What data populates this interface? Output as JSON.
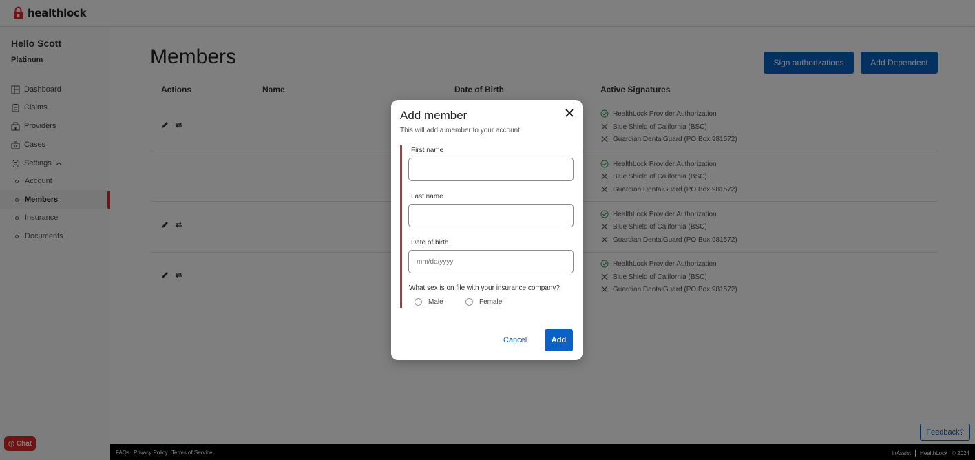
{
  "app": {
    "brand": "healthlock"
  },
  "sidebar": {
    "greeting": "Hello Scott",
    "tier": "Platinum",
    "items": [
      {
        "label": "Dashboard",
        "icon": "dashboard-icon"
      },
      {
        "label": "Claims",
        "icon": "clipboard-icon"
      },
      {
        "label": "Providers",
        "icon": "building-icon"
      },
      {
        "label": "Cases",
        "icon": "briefcase-icon"
      },
      {
        "label": "Settings",
        "icon": "gear-icon"
      }
    ],
    "sub_items": [
      {
        "label": "Account"
      },
      {
        "label": "Members",
        "active": true
      },
      {
        "label": "Insurance"
      },
      {
        "label": "Documents"
      }
    ]
  },
  "chat": {
    "label": "Chat"
  },
  "main": {
    "title": "Members",
    "sign_label": "Sign authorizations",
    "add_dependent_label": "Add Dependent",
    "columns": [
      "Actions",
      "Name",
      "Date of Birth",
      "Active Signatures"
    ],
    "rows": [
      {
        "has_actions": true,
        "signatures": [
          {
            "name": "HealthLock Provider Authorization",
            "status": "active"
          },
          {
            "name": "Blue Shield of California (BSC)",
            "status": "inactive"
          },
          {
            "name": "Guardian DentalGuard (PO Box 981572)",
            "status": "inactive"
          }
        ]
      },
      {
        "has_actions": false,
        "signatures": [
          {
            "name": "HealthLock Provider Authorization",
            "status": "active"
          },
          {
            "name": "Blue Shield of California (BSC)",
            "status": "inactive"
          },
          {
            "name": "Guardian DentalGuard (PO Box 981572)",
            "status": "inactive"
          }
        ]
      },
      {
        "has_actions": true,
        "signatures": [
          {
            "name": "HealthLock Provider Authorization",
            "status": "active"
          },
          {
            "name": "Blue Shield of California (BSC)",
            "status": "inactive"
          },
          {
            "name": "Guardian DentalGuard (PO Box 981572)",
            "status": "inactive"
          }
        ]
      },
      {
        "has_actions": true,
        "signatures": [
          {
            "name": "HealthLock Provider Authorization",
            "status": "active"
          },
          {
            "name": "Blue Shield of California (BSC)",
            "status": "inactive"
          },
          {
            "name": "Guardian DentalGuard (PO Box 981572)",
            "status": "inactive"
          }
        ]
      }
    ],
    "feedback_label": "Feedback?"
  },
  "footer": {
    "links": [
      "FAQs",
      "Privacy Policy",
      "Terms of Service"
    ],
    "right_items": [
      "InAssist",
      "HealthLock",
      "© 2024"
    ]
  },
  "modal": {
    "title": "Add member",
    "subtitle": "This will add a member to your account.",
    "first_name_label": "First name",
    "first_name_value": "",
    "last_name_label": "Last name",
    "last_name_value": "",
    "dob_label": "Date of birth",
    "dob_placeholder": "mm/dd/yyyy",
    "sex_question": "What sex is on file with your insurance company?",
    "sex_options": [
      "Male",
      "Female"
    ],
    "cancel_label": "Cancel",
    "add_label": "Add"
  },
  "colors": {
    "accent": "#0b61c4",
    "brand_red": "#e0262b",
    "active_green": "#2e9a5a"
  }
}
